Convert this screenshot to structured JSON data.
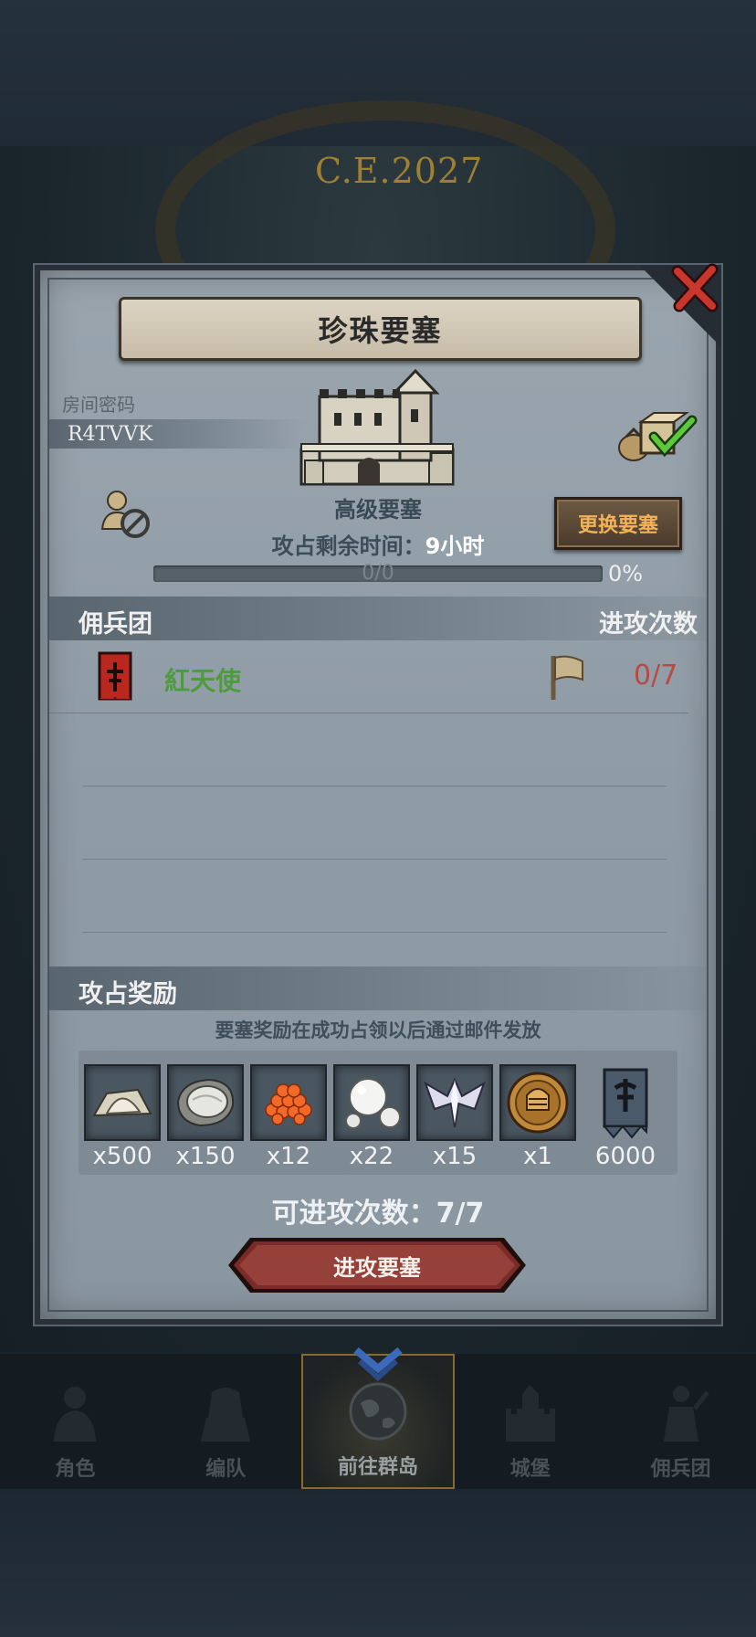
{
  "background": {
    "era": "C.E.2027"
  },
  "dialog": {
    "title": "珍珠要塞",
    "room_label": "房间密码",
    "room_code": "R4TVVK",
    "fortress_level": "高级要塞",
    "change_button": "更换要塞",
    "time_label": "攻占剩余时间：",
    "time_value": "9小时",
    "progress_text": "0/0",
    "progress_percent": "0%",
    "progress_fraction": 0
  },
  "mercenary_section": {
    "title": "佣兵团",
    "right_label": "进攻次数",
    "rows": [
      {
        "name": "紅天使",
        "attack_count": "0/7"
      }
    ]
  },
  "rewards_section": {
    "title": "攻占奖励",
    "note": "要塞奖励在成功占领以后通过邮件发放",
    "items": [
      {
        "icon": "flour-icon",
        "qty": "x500"
      },
      {
        "icon": "oyster-icon",
        "qty": "x150"
      },
      {
        "icon": "fish-roe-icon",
        "qty": "x12"
      },
      {
        "icon": "pearl-icon",
        "qty": "x22"
      },
      {
        "icon": "wing-crest-icon",
        "qty": "x15"
      },
      {
        "icon": "knight-coin-icon",
        "qty": "x1"
      },
      {
        "icon": "banner-icon",
        "qty": "6000"
      }
    ]
  },
  "attempts": {
    "label": "可进攻次数：",
    "value": "7/7"
  },
  "attack_button": "进攻要塞",
  "nav": {
    "items": [
      {
        "label": "角色",
        "icon": "character-icon",
        "active": false
      },
      {
        "label": "编队",
        "icon": "formation-icon",
        "active": false
      },
      {
        "label": "前往群岛",
        "icon": "globe-icon",
        "active": true
      },
      {
        "label": "城堡",
        "icon": "castle-icon",
        "active": false
      },
      {
        "label": "佣兵团",
        "icon": "mercenary-icon",
        "active": false
      }
    ]
  },
  "colors": {
    "panel": "#9aa5ae",
    "accent_orange": "#f2b25a",
    "merc_name_green": "#4e9a3e",
    "count_red": "#b84a44",
    "button_red": "#7a2a28"
  }
}
